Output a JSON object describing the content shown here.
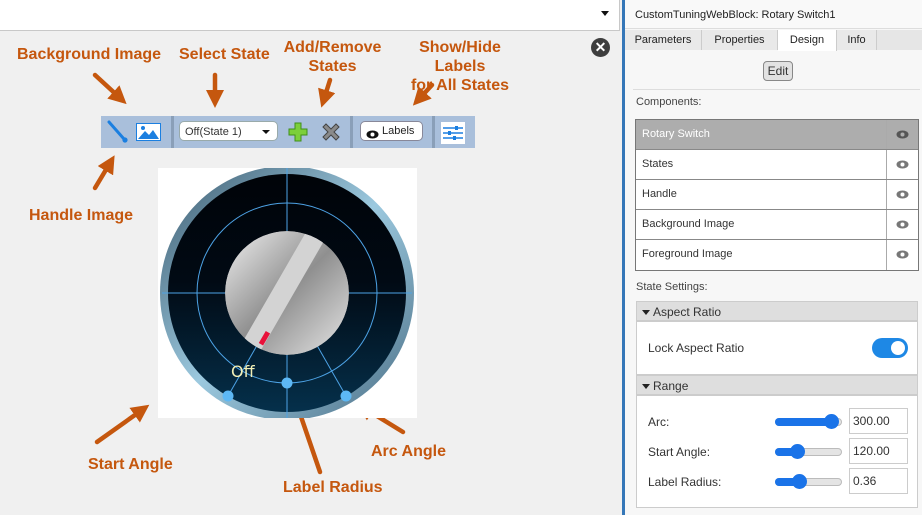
{
  "left_panel": {
    "top_dropdown_value": "",
    "close_icon": "close-circle-icon",
    "annotations": {
      "background_image": "Background Image",
      "select_state": "Select State",
      "add_remove_states": [
        "Add/Remove",
        "States"
      ],
      "show_hide_labels": [
        "Show/Hide Labels",
        "for All States"
      ],
      "handle_image": "Handle Image",
      "start_angle": "Start Angle",
      "label_radius": "Label Radius",
      "arc_angle": "Arc Angle"
    },
    "toolbar": {
      "handle_icon": "needle-handle-icon",
      "background_icon": "image-icon",
      "state_select_value": "Off(State 1)",
      "add_icon": "plus-icon",
      "remove_icon": "x-icon",
      "labels_button": "Labels",
      "settings_icon": "sliders-icon"
    },
    "knob": {
      "state_label": "Off",
      "colors": {
        "bezel": "#5f8aa3",
        "face_top": "#000308",
        "face_bottom": "#052e48",
        "grid": "#4da3e6",
        "point": "#5db8f5",
        "indicator": "#e8123a"
      }
    }
  },
  "right_panel": {
    "title": "CustomTuningWebBlock: Rotary Switch1",
    "tabs": [
      {
        "label": "Parameters",
        "active": false
      },
      {
        "label": "Properties",
        "active": false
      },
      {
        "label": "Design",
        "active": true
      },
      {
        "label": "Info",
        "active": false
      }
    ],
    "edit_button": "Edit",
    "components_label": "Components:",
    "components": [
      {
        "label": "Rotary Switch",
        "selected": true
      },
      {
        "label": "States",
        "selected": false
      },
      {
        "label": "Handle",
        "selected": false
      },
      {
        "label": "Background Image",
        "selected": false
      },
      {
        "label": "Foreground Image",
        "selected": false
      }
    ],
    "state_settings_label": "State Settings:",
    "aspect_ratio": {
      "header": "Aspect Ratio",
      "lock_label": "Lock Aspect Ratio",
      "lock_on": true
    },
    "range": {
      "header": "Range",
      "fields": [
        {
          "label": "Arc:",
          "value": "300.00",
          "slider_fraction": 0.84
        },
        {
          "label": "Start Angle:",
          "value": "120.00",
          "slider_fraction": 0.33
        },
        {
          "label": "Label Radius:",
          "value": "0.36",
          "slider_fraction": 0.36
        }
      ]
    },
    "accent_color": "#1a73e8"
  }
}
